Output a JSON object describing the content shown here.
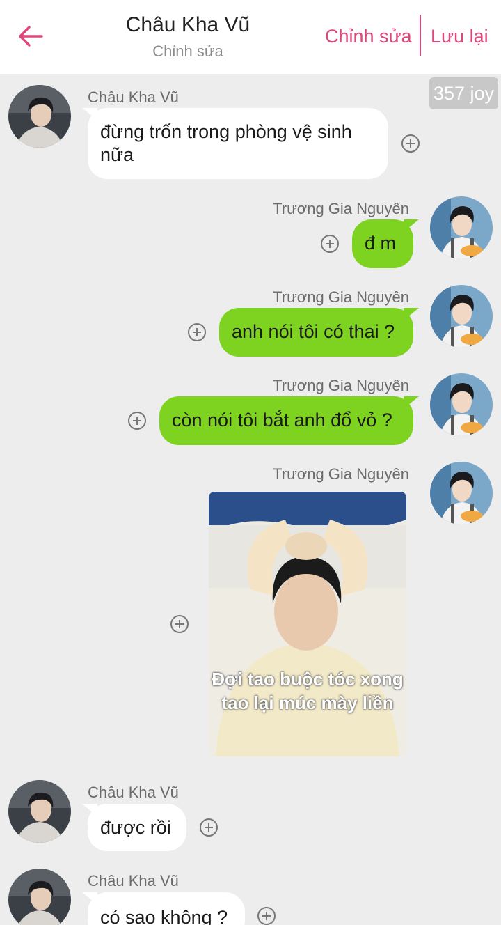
{
  "header": {
    "title": "Châu Kha Vũ",
    "subtitle": "Chỉnh sửa",
    "edit_label": "Chỉnh sửa",
    "save_label": "Lưu lại",
    "back_icon": "arrow-left-icon",
    "accent_color": "#e0457b"
  },
  "badge": {
    "text": "357 joy"
  },
  "colors": {
    "background": "#ededed",
    "incoming_bubble": "#ffffff",
    "outgoing_bubble": "#7ed321"
  },
  "messages": [
    {
      "sender": "Châu Kha Vũ",
      "side": "left",
      "text": "đừng trốn trong phòng vệ sinh nữa"
    },
    {
      "sender": "Trương Gia Nguyên",
      "side": "right",
      "text": "đ m"
    },
    {
      "sender": "Trương Gia Nguyên",
      "side": "right",
      "text": "anh nói tôi có thai ?"
    },
    {
      "sender": "Trương Gia Nguyên",
      "side": "right",
      "text": "còn nói tôi bắt anh đổ vỏ ?"
    },
    {
      "sender": "Trương Gia Nguyên",
      "side": "right",
      "image_caption": "Đợi tao buộc tóc xong tao lại múc mày liền"
    },
    {
      "sender": "Châu Kha Vũ",
      "side": "left",
      "text": "được rồi"
    },
    {
      "sender": "Châu Kha Vũ",
      "side": "left",
      "text": "có sao không ?"
    }
  ]
}
